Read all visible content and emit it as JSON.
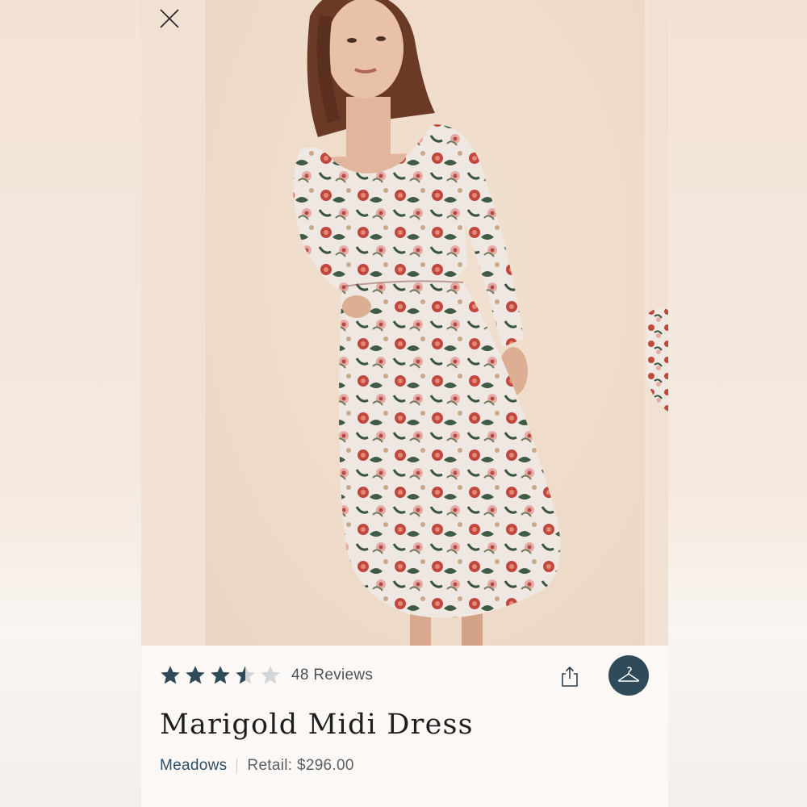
{
  "product": {
    "title": "Marigold Midi Dress",
    "brand": "Meadows",
    "retail_label": "Retail: $296.00",
    "rating": 3.5,
    "rating_max": 5,
    "reviews_label": "48 Reviews"
  },
  "icons": {
    "close": "close-icon",
    "share": "share-icon",
    "hanger": "hanger-icon",
    "star": "star-icon"
  },
  "colors": {
    "star_filled": "#2f4b59",
    "star_empty": "#d3d5d7",
    "accent": "#2f4b59",
    "brand_link": "#2e4f67"
  }
}
